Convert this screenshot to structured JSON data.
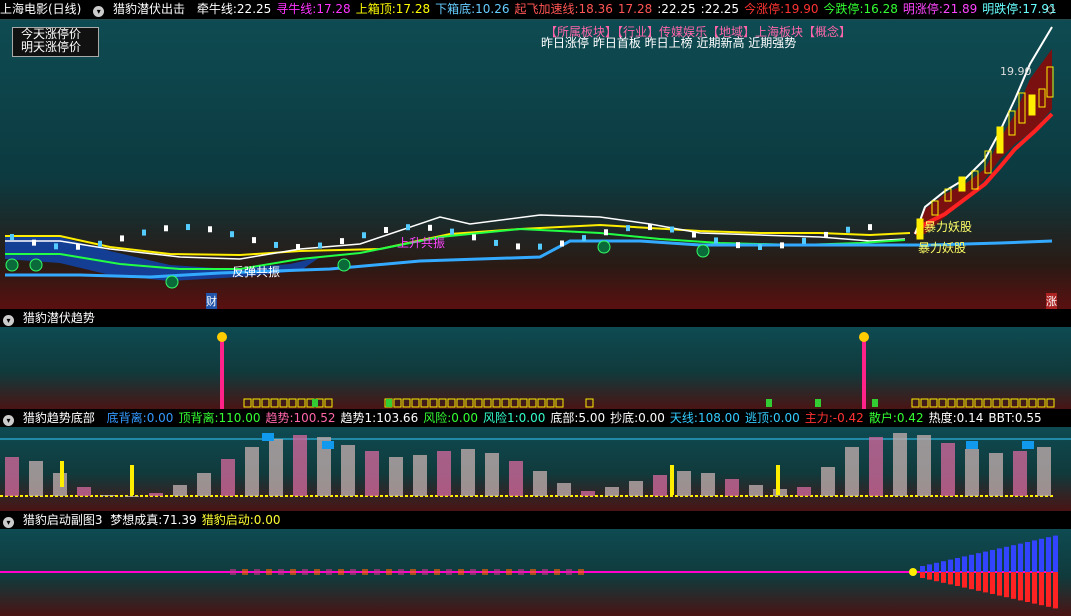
{
  "main": {
    "title": "上海电影(日线)",
    "indicator": "猎豹潜伏出击",
    "stats": [
      {
        "label": "牵牛线:",
        "value": "22.25",
        "color": "#ffffff"
      },
      {
        "label": "寻牛线:",
        "value": "17.28",
        "color": "#ff33ff"
      },
      {
        "label": "上箱顶:",
        "value": "17.28",
        "color": "#ffff00"
      },
      {
        "label": "下箱底:",
        "value": "10.26",
        "color": "#66ccff"
      },
      {
        "label": "起飞加速线:",
        "value": "18.36",
        "color": "#ff5555"
      },
      {
        "label": "",
        "value": "17.28",
        "color": "#ff5555"
      },
      {
        "label": ":",
        "value": "22.25",
        "color": "#ffffff"
      },
      {
        "label": ":",
        "value": "22.25",
        "color": "#ffffff"
      },
      {
        "label": "今涨停:",
        "value": "19.90",
        "color": "#ff3333"
      },
      {
        "label": "今跌停:",
        "value": "16.28",
        "color": "#33ff33"
      },
      {
        "label": "明涨停:",
        "value": "21.89",
        "color": "#ff44ff"
      },
      {
        "label": "明跌停:",
        "value": "17.91",
        "color": "#66ffff"
      }
    ],
    "diamond": "◇",
    "box_lines": [
      "今天涨停价",
      "明天涨停价"
    ],
    "sector_line": "【所属板块】【行业】传媒娱乐【地域】上海板块【概念】",
    "tags_line": "昨日涨停 昨日首板 昨日上榜 近期新高 近期强势",
    "price_label": "19.90",
    "annotations": {
      "baoli1": "暴力妖股",
      "baoli2": "暴力妖股",
      "fantan": "反弹共振",
      "zhangsheng": "上升共振",
      "cai": "财",
      "zhang": "涨"
    }
  },
  "pane2": {
    "title": "猎豹潜伏趋势"
  },
  "pane3": {
    "title": "猎豹趋势底部",
    "stats": [
      {
        "label": "底背离:",
        "value": "0.00",
        "color": "#3399ff"
      },
      {
        "label": "顶背离:",
        "value": "110.00",
        "color": "#33ff33"
      },
      {
        "label": "趋势:",
        "value": "100.52",
        "color": "#ff66aa"
      },
      {
        "label": "趋势1:",
        "value": "103.66",
        "color": "#ffffff"
      },
      {
        "label": "风险:",
        "value": "0.00",
        "color": "#33ff33"
      },
      {
        "label": "风险1:",
        "value": "0.00",
        "color": "#33ffcc"
      },
      {
        "label": "底部:",
        "value": "5.00",
        "color": "#ffffff"
      },
      {
        "label": "抄底:",
        "value": "0.00",
        "color": "#ffffff"
      },
      {
        "label": "天线:",
        "value": "108.00",
        "color": "#33ccff"
      },
      {
        "label": "逃顶:",
        "value": "0.00",
        "color": "#33ccff"
      },
      {
        "label": "主力:",
        "value": "-0.42",
        "color": "#ff3333"
      },
      {
        "label": "散户:",
        "value": "0.42",
        "color": "#33ff33"
      },
      {
        "label": "热度:",
        "value": "0.14",
        "color": "#ffffff"
      },
      {
        "label": "BBT:",
        "value": "0.55",
        "color": "#ffffff"
      }
    ]
  },
  "pane4": {
    "title": "猎豹启动副图3",
    "stats": [
      {
        "label": "梦想成真:",
        "value": "71.39",
        "color": "#ffffff"
      },
      {
        "label": "猎豹启动:",
        "value": "0.00",
        "color": "#ffff33"
      }
    ]
  },
  "colors": {
    "red_line": "#ff2222",
    "blue_line": "#33aaff",
    "yellow_line": "#ffee00",
    "magenta": "#ff00cc"
  }
}
